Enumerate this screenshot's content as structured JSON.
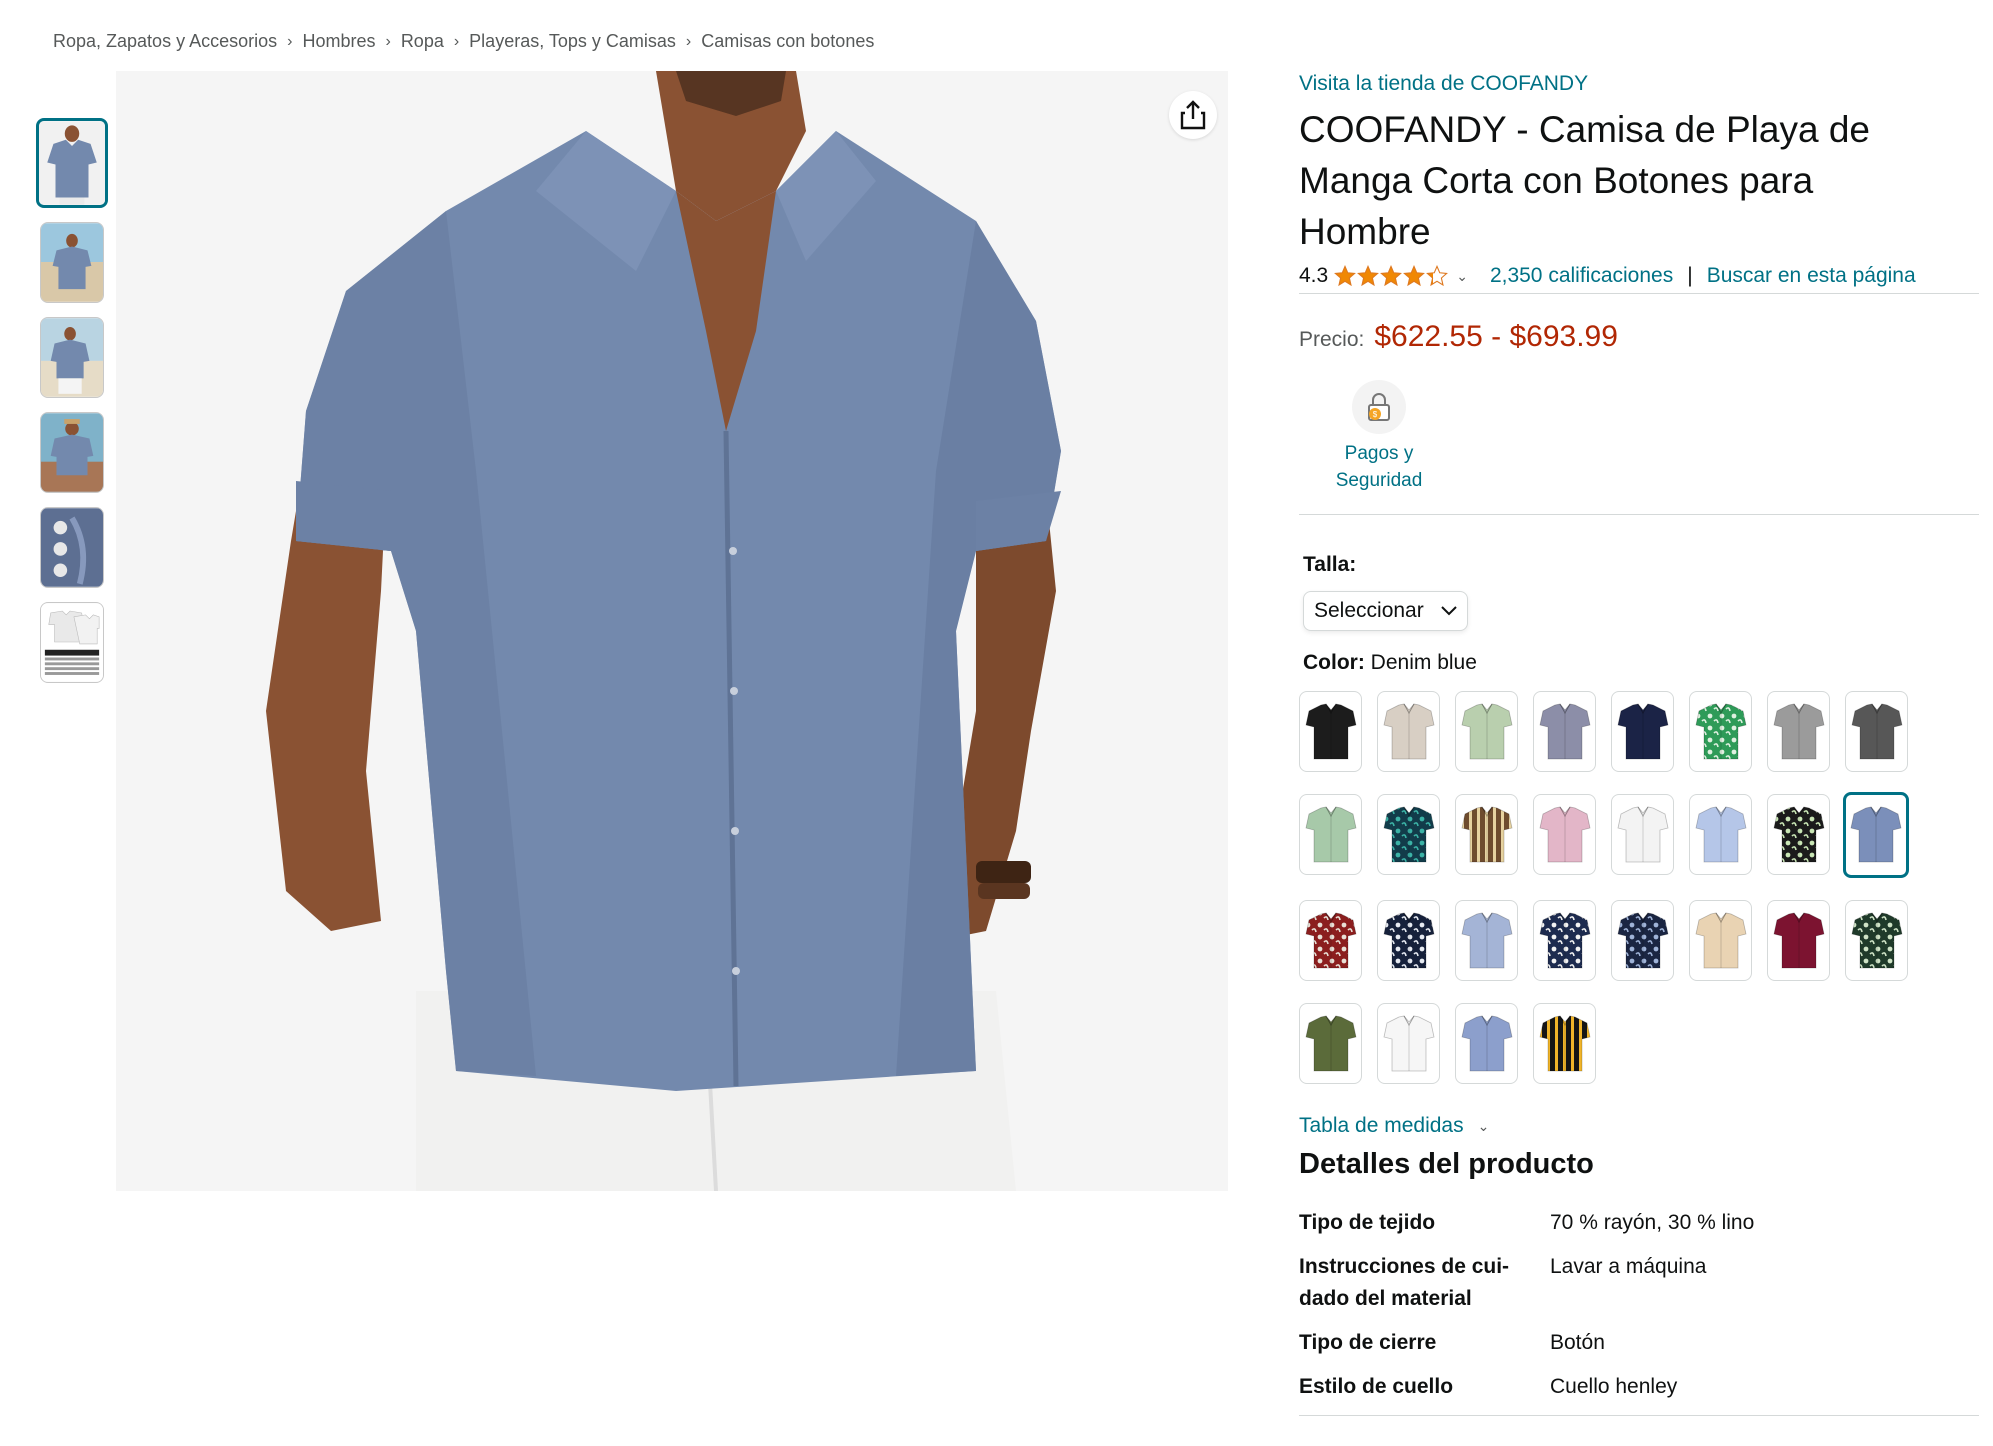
{
  "breadcrumb": [
    "Ropa, Zapatos y Accesorios",
    "Hombres",
    "Ropa",
    "Playeras, Tops y Camisas",
    "Camisas con botones"
  ],
  "breadcrumb_separator": "›",
  "thumbnails": [
    {
      "name": "thumb-1",
      "kind": "model-front",
      "active": true
    },
    {
      "name": "thumb-2",
      "kind": "beach-1"
    },
    {
      "name": "thumb-3",
      "kind": "beach-2"
    },
    {
      "name": "thumb-4",
      "kind": "beach-3"
    },
    {
      "name": "thumb-5",
      "kind": "buttons-detail"
    },
    {
      "name": "thumb-6",
      "kind": "size-chart"
    }
  ],
  "main_image": {
    "subject": "man wearing denim blue short sleeve button-up shirt with white pants",
    "shirt_color": "#7389ad",
    "skin_color": "#8a5233",
    "pants_color": "#f1f1f0"
  },
  "share_icon": "share-icon",
  "product": {
    "store_link": "Visita la tienda de COOFANDY",
    "title": "COOFANDY - Camisa de Playa de Manga Corta con Botones para Hombre",
    "rating": "4.3",
    "rating_fraction": 0.86,
    "star_color": "#f08804",
    "ratings_count": "2,350 calificaciones",
    "search_page": "Buscar en esta página",
    "price_label": "Precio:",
    "price_range": "$622.55 - $693.99",
    "price_color": "#b12704",
    "payments_label_1": "Pagos y",
    "payments_label_2": "Seguridad",
    "payments_icon": "lock-icon"
  },
  "size": {
    "label": "Talla:",
    "select_value": "Seleccionar"
  },
  "color": {
    "label": "Color:",
    "selected": "Denim blue"
  },
  "swatches": [
    {
      "name": "black",
      "fill": "#1c1c1c",
      "pattern": "solid"
    },
    {
      "name": "khaki",
      "fill": "#d8cfc4",
      "pattern": "solid"
    },
    {
      "name": "sage-green",
      "fill": "#b9cfae",
      "pattern": "solid"
    },
    {
      "name": "grey-blue",
      "fill": "#8c8ea8",
      "pattern": "solid"
    },
    {
      "name": "navy",
      "fill": "#1b2346",
      "pattern": "solid"
    },
    {
      "name": "green-leaf",
      "fill": "#2e9b58",
      "pattern": "floral",
      "accent": "#dff0e0"
    },
    {
      "name": "light-grey",
      "fill": "#9b9b9b",
      "pattern": "solid"
    },
    {
      "name": "dark-grey",
      "fill": "#575757",
      "pattern": "solid"
    },
    {
      "name": "mint",
      "fill": "#a7c9a9",
      "pattern": "solid"
    },
    {
      "name": "teal-floral",
      "fill": "#123c4a",
      "pattern": "floral",
      "accent": "#3bb3a6"
    },
    {
      "name": "stripes-brown",
      "fill": "#6e4c2e",
      "pattern": "stripes",
      "accent": "#e6d2a0"
    },
    {
      "name": "pink",
      "fill": "#e3b6c8",
      "pattern": "solid"
    },
    {
      "name": "white",
      "fill": "#f3f3f3",
      "pattern": "solid"
    },
    {
      "name": "light-blue",
      "fill": "#b5c6e8",
      "pattern": "solid"
    },
    {
      "name": "black-leaf",
      "fill": "#1b1b1b",
      "pattern": "floral",
      "accent": "#c9e6b5"
    },
    {
      "name": "denim-blue",
      "fill": "#7b8fba",
      "pattern": "solid",
      "selected": true
    },
    {
      "name": "red-floral",
      "fill": "#8b1e1e",
      "pattern": "floral",
      "accent": "#e8e0d6"
    },
    {
      "name": "navy-floral",
      "fill": "#16213b",
      "pattern": "floral",
      "accent": "#e7ebf2"
    },
    {
      "name": "powder-blue",
      "fill": "#a4b4d6",
      "pattern": "solid"
    },
    {
      "name": "navy-white-floral",
      "fill": "#1d2b4f",
      "pattern": "floral",
      "accent": "#f2f2f2"
    },
    {
      "name": "blue-floral",
      "fill": "#1a2542",
      "pattern": "floral",
      "accent": "#9fb3d8"
    },
    {
      "name": "beige",
      "fill": "#e9d3b3",
      "pattern": "solid"
    },
    {
      "name": "burgundy",
      "fill": "#7c1330",
      "pattern": "solid"
    },
    {
      "name": "green-floral",
      "fill": "#1f3a2a",
      "pattern": "floral",
      "accent": "#cfe3c6"
    },
    {
      "name": "olive",
      "fill": "#5b6b3a",
      "pattern": "solid"
    },
    {
      "name": "white-2",
      "fill": "#f6f6f6",
      "pattern": "solid"
    },
    {
      "name": "periwinkle",
      "fill": "#8c9fcc",
      "pattern": "solid"
    },
    {
      "name": "stripe-black",
      "fill": "#151515",
      "pattern": "stripes",
      "accent": "#f0b429"
    }
  ],
  "size_chart": "Tabla de medidas",
  "details_title": "Detalles del producto",
  "details": [
    {
      "key": "Tipo de tejido",
      "value": "70 % rayón, 30 % lino"
    },
    {
      "key": "Instrucciones de cui-dado del material",
      "value": "Lavar a máquina"
    },
    {
      "key": "Tipo de cierre",
      "value": "Botón"
    },
    {
      "key": "Estilo de cuello",
      "value": "Cuello henley"
    }
  ]
}
